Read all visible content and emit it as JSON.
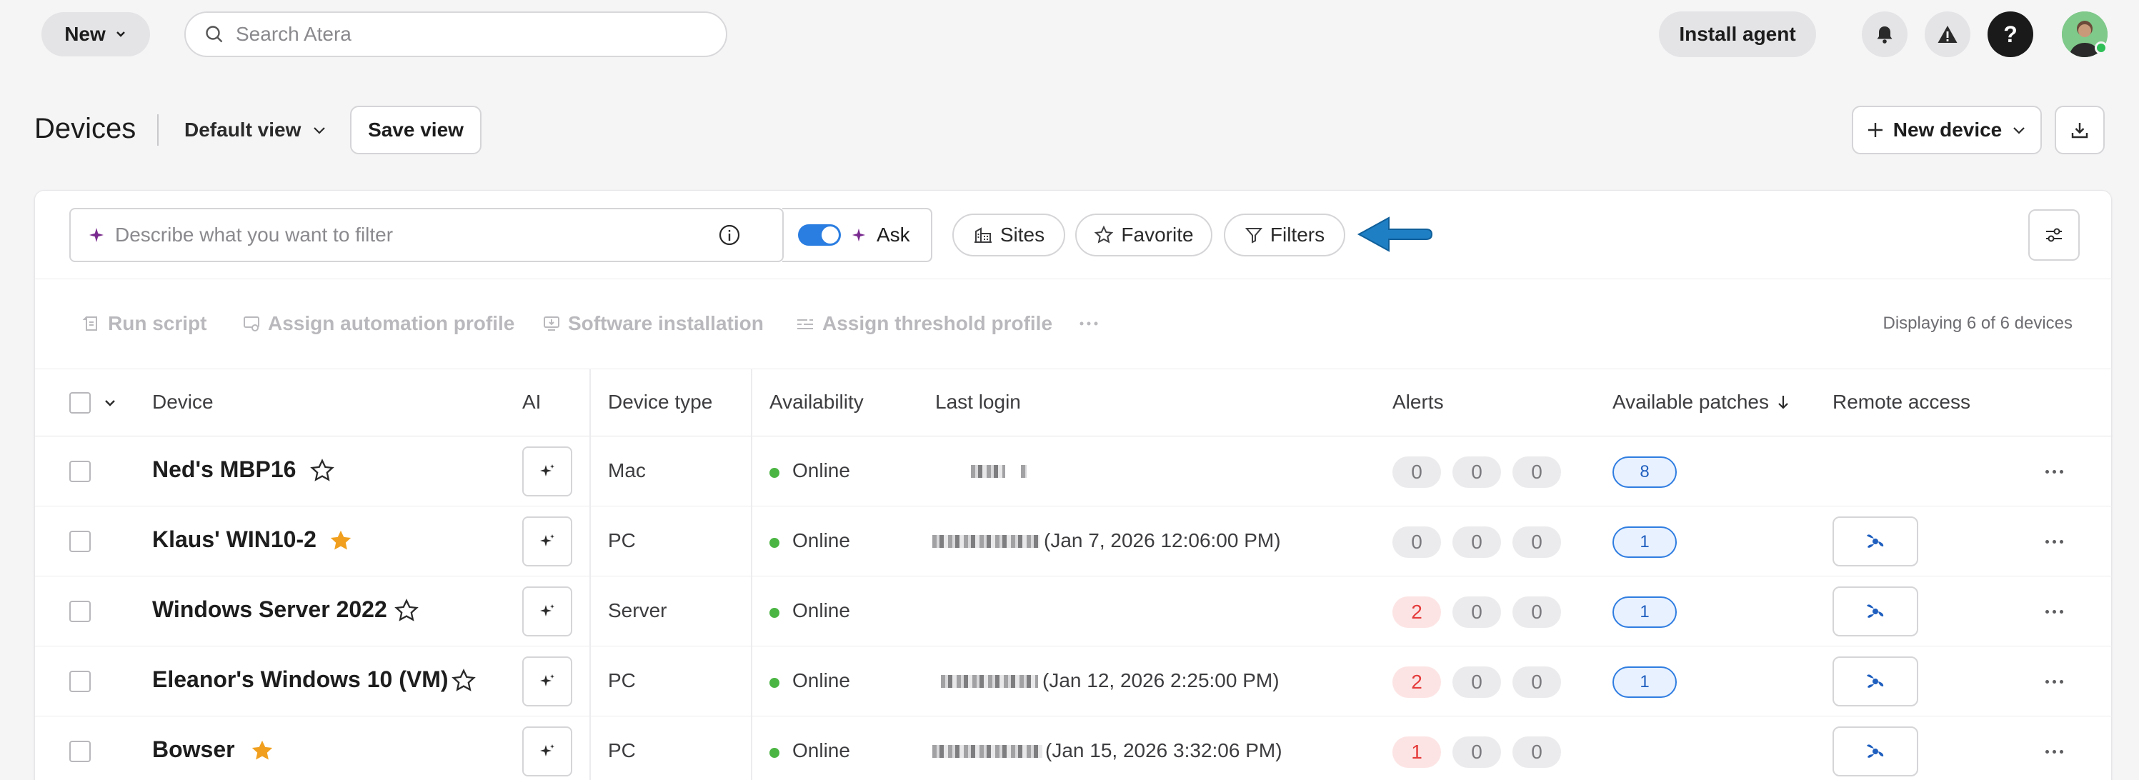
{
  "topbar": {
    "new_label": "New",
    "search_placeholder": "Search Atera",
    "install_label": "Install agent",
    "help_label": "?"
  },
  "header": {
    "title": "Devices",
    "view_label": "Default view",
    "save_view_label": "Save view",
    "new_device_label": "New device"
  },
  "filters": {
    "ai_placeholder": "Describe what you want to filter",
    "ask_label": "Ask",
    "ask_enabled": true,
    "sites_label": "Sites",
    "favorite_label": "Favorite",
    "filters_label": "Filters"
  },
  "actions": {
    "run_script": "Run script",
    "assign_automation": "Assign automation profile",
    "software_install": "Software installation",
    "assign_threshold": "Assign threshold profile",
    "displaying": "Displaying 6 of 6 devices"
  },
  "table": {
    "headers": {
      "device": "Device",
      "ai": "AI",
      "device_type": "Device type",
      "availability": "Availability",
      "last_login": "Last login",
      "alerts": "Alerts",
      "patches": "Available patches",
      "remote": "Remote access"
    },
    "rows": [
      {
        "name": "Ned's MBP16",
        "favorite": false,
        "type": "Mac",
        "availability": "Online",
        "login": "",
        "alerts": [
          "0",
          "0",
          "0"
        ],
        "alert_red": false,
        "patches": "8",
        "remote": false
      },
      {
        "name": "Klaus' WIN10-2",
        "favorite": true,
        "type": "PC",
        "availability": "Online",
        "login": "(Jan 7, 2026 12:06:00 PM)",
        "alerts": [
          "0",
          "0",
          "0"
        ],
        "alert_red": false,
        "patches": "1",
        "remote": true
      },
      {
        "name": "Windows Server 2022",
        "favorite": false,
        "type": "Server",
        "availability": "Online",
        "login": "",
        "alerts": [
          "2",
          "0",
          "0"
        ],
        "alert_red": true,
        "patches": "1",
        "remote": true
      },
      {
        "name": "Eleanor's Windows 10 (VM)",
        "favorite": false,
        "type": "PC",
        "availability": "Online",
        "login": "(Jan 12, 2026 2:25:00 PM)",
        "alerts": [
          "2",
          "0",
          "0"
        ],
        "alert_red": true,
        "patches": "1",
        "remote": true
      },
      {
        "name": "Bowser",
        "favorite": true,
        "type": "PC",
        "availability": "Online",
        "login": "(Jan 15, 2026 3:32:06 PM)",
        "alerts": [
          "1",
          "0",
          "0"
        ],
        "alert_red": true,
        "patches": "",
        "remote": true
      }
    ]
  },
  "colors": {
    "accent": "#2a7de1",
    "star": "#f0a01e",
    "online": "#4bb543",
    "alert_red": "#e53b3b"
  }
}
